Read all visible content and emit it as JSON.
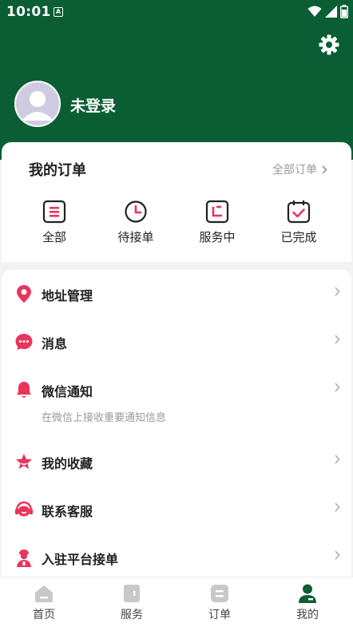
{
  "status_bar": {
    "time": "10:01",
    "notification_badge": "A"
  },
  "profile": {
    "username": "未登录"
  },
  "orders": {
    "title": "我的订单",
    "all_link": "全部订单",
    "items": [
      {
        "label": "全部",
        "icon": "list-icon"
      },
      {
        "label": "待接单",
        "icon": "clock-icon"
      },
      {
        "label": "服务中",
        "icon": "service-icon"
      },
      {
        "label": "已完成",
        "icon": "calendar-check-icon"
      }
    ]
  },
  "menu": {
    "items": [
      {
        "label": "地址管理",
        "icon": "location-pin-icon"
      },
      {
        "label": "消息",
        "icon": "message-icon"
      },
      {
        "label": "微信通知",
        "icon": "bell-icon",
        "subtitle": "在微信上接收重要通知信息"
      },
      {
        "label": "我的收藏",
        "icon": "star-icon"
      },
      {
        "label": "联系客服",
        "icon": "headset-icon"
      },
      {
        "label": "入驻平台接单",
        "icon": "worker-icon"
      }
    ]
  },
  "tabbar": {
    "tabs": [
      {
        "label": "首页",
        "icon": "home-icon",
        "active": false
      },
      {
        "label": "服务",
        "icon": "service-door-icon",
        "active": false
      },
      {
        "label": "订单",
        "icon": "order-icon",
        "active": false
      },
      {
        "label": "我的",
        "icon": "person-icon",
        "active": true
      }
    ]
  },
  "colors": {
    "header_green": "#0b5e34",
    "accent_red": "#e8355a",
    "active_tab": "#0b5e34",
    "inactive_tab": "#c8c8c8"
  }
}
